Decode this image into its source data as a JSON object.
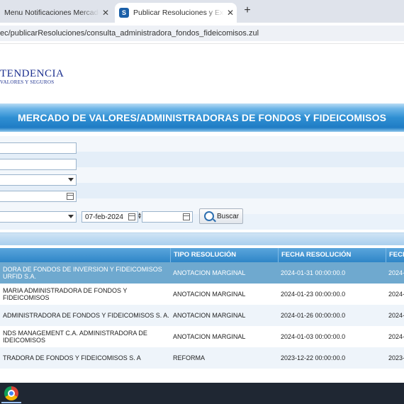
{
  "browser": {
    "tabs": [
      {
        "label": "Menu Notificaciones MercadoValores",
        "active": false
      },
      {
        "label": "Publicar Resoluciones y Extractos",
        "active": true
      }
    ],
    "new_tab_symbol": "+",
    "close_symbol": "✕",
    "url": "ec/publicarResoluciones/consulta_administradora_fondos_fideicomisos.zul"
  },
  "header": {
    "logo_line1": "TENDENCIA",
    "logo_line2": "VALORES Y SEGUROS",
    "banner_title": "MERCADO DE VALORES/ADMINISTRADORAS DE FONDOS Y FIDEICOMISOS"
  },
  "form": {
    "date_to": "07-feb-2024",
    "search_label": "Buscar"
  },
  "grid": {
    "columns": [
      "",
      "TIPO RESOLUCIÓN",
      "FECHA RESOLUCIÓN",
      "FECH"
    ],
    "rows": [
      {
        "entity": "DORA DE FONDOS DE INVERSION Y FIDEICOMISOS URFID S.A.",
        "tipo": "ANOTACION MARGINAL",
        "fecha": "2024-01-31 00:00:00.0",
        "fecha2": "2024-",
        "selected": true
      },
      {
        "entity": "MARIA ADMINISTRADORA DE FONDOS Y FIDEICOMISOS",
        "tipo": "ANOTACION MARGINAL",
        "fecha": "2024-01-23 00:00:00.0",
        "fecha2": "2024-",
        "selected": false
      },
      {
        "entity": "ADMINISTRADORA DE FONDOS Y FIDEICOMISOS S. A.",
        "tipo": "ANOTACION MARGINAL",
        "fecha": "2024-01-26 00:00:00.0",
        "fecha2": "2024-",
        "selected": false
      },
      {
        "entity": "NDS MANAGEMENT C.A. ADMINISTRADORA DE IDEICOMISOS",
        "tipo": "ANOTACION MARGINAL",
        "fecha": "2024-01-03 00:00:00.0",
        "fecha2": "2024-",
        "selected": false
      },
      {
        "entity": "TRADORA DE FONDOS Y FIDEICOMISOS S. A",
        "tipo": "REFORMA",
        "fecha": "2023-12-22 00:00:00.0",
        "fecha2": "2023-",
        "selected": false
      }
    ]
  },
  "taskbar": {
    "app_icon": "chrome-icon"
  },
  "colors": {
    "banner": "#2f8fd3",
    "logo": "#1b2f8f",
    "selected_row": "#6fa9cf",
    "grid_header": "#2f86c8"
  }
}
